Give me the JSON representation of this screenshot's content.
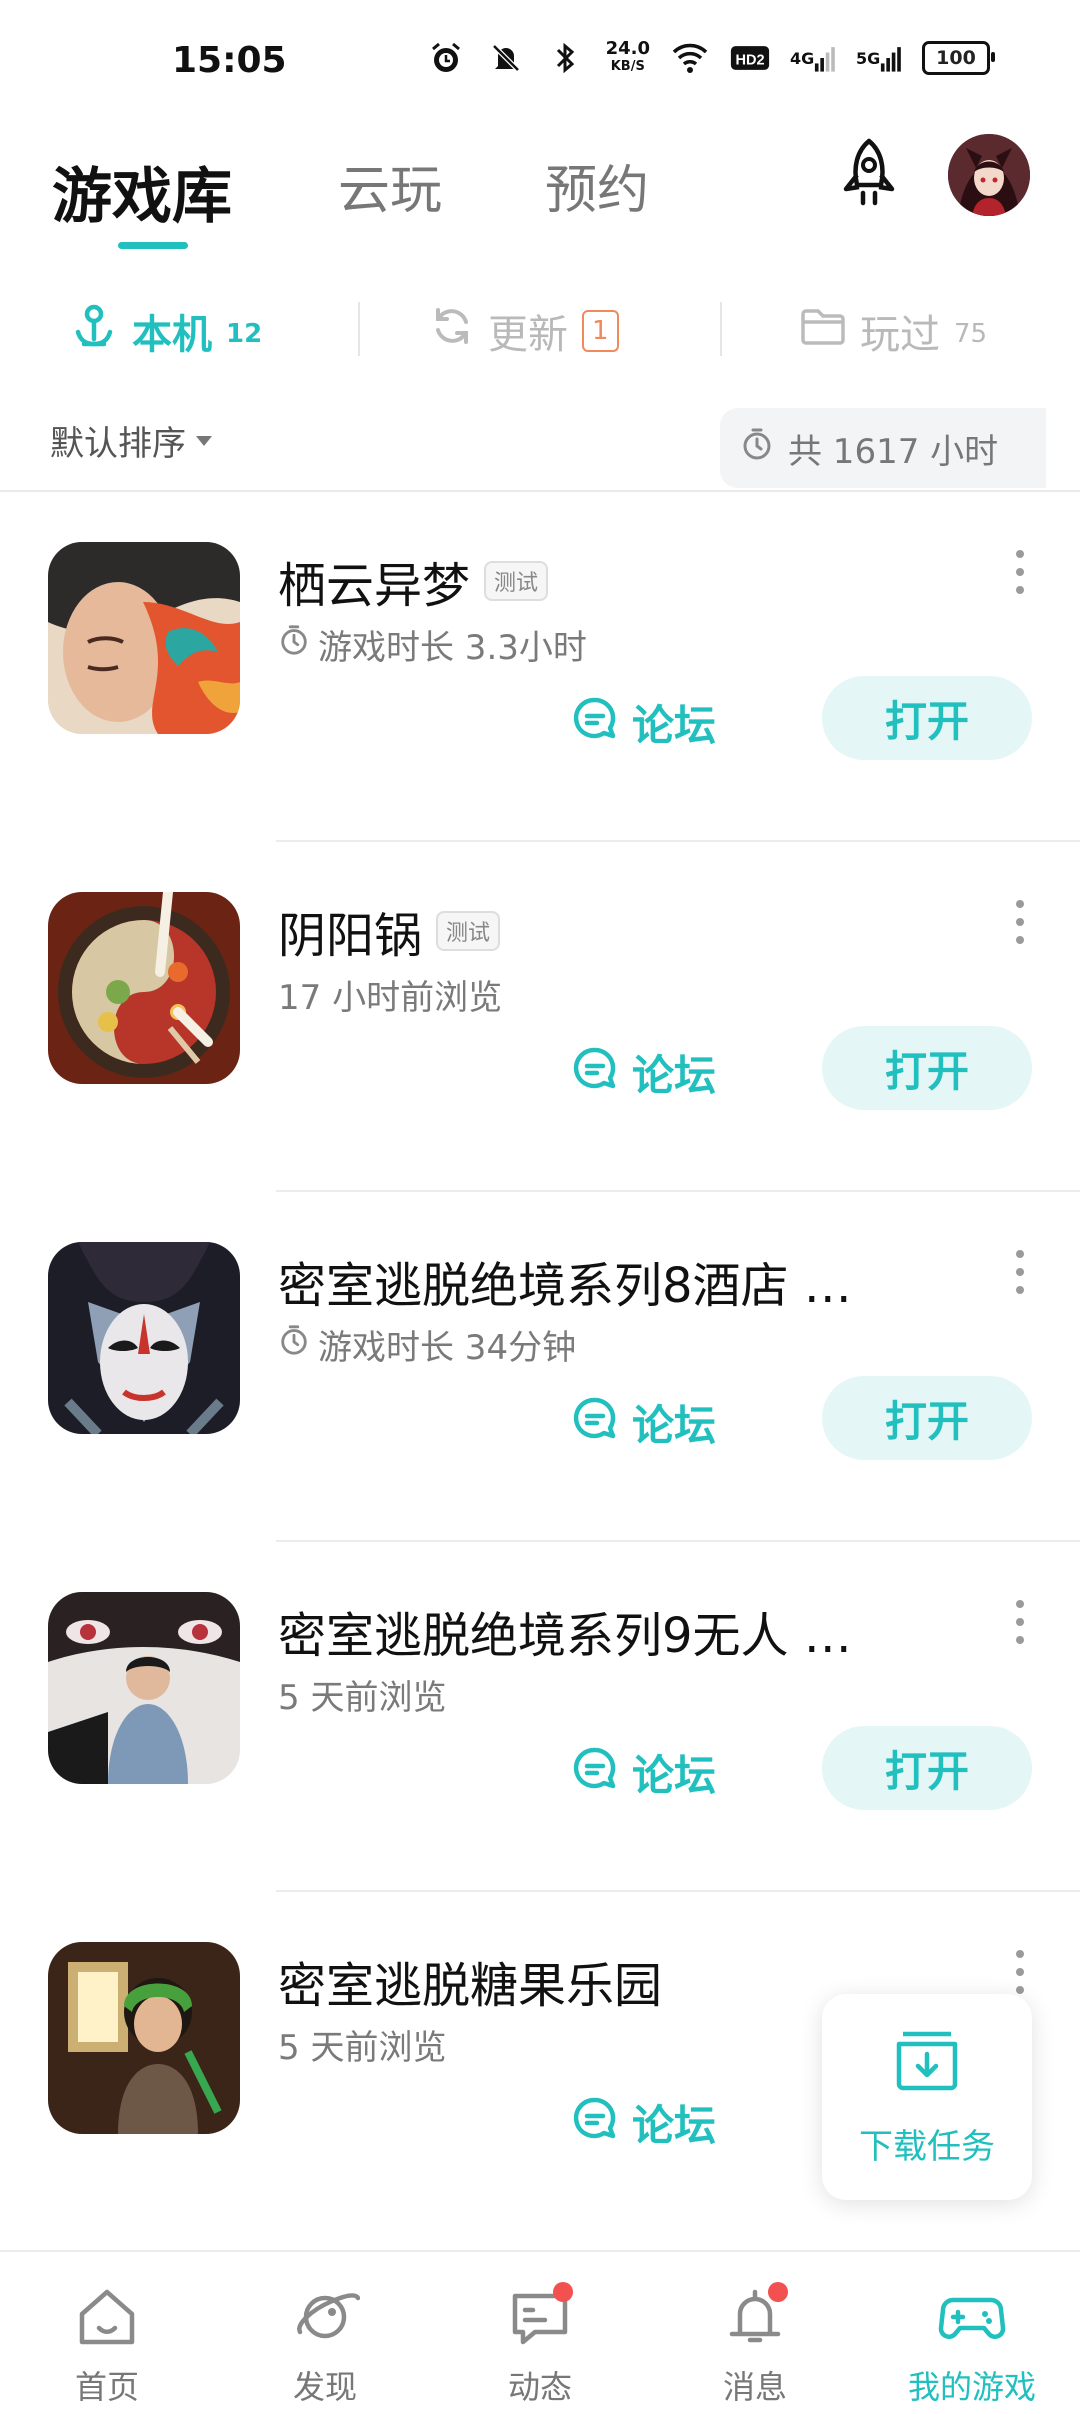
{
  "status_bar": {
    "time": "15:05",
    "speed_value": "24.0",
    "speed_unit": "KB/S",
    "hd_label": "HD2",
    "net1": "4G",
    "net2": "5G",
    "battery": "100"
  },
  "top_nav": {
    "tabs": [
      "游戏库",
      "云玩",
      "预约"
    ],
    "active_tab": "游戏库"
  },
  "sub_tabs": [
    {
      "label": "本机",
      "count": "12",
      "icon": "anchor-icon"
    },
    {
      "label": "更新",
      "badge": "1",
      "icon": "refresh-icon"
    },
    {
      "label": "玩过",
      "count": "75",
      "icon": "folder-icon"
    }
  ],
  "sort": {
    "label": "默认排序"
  },
  "total": {
    "text": "共 1617 小时"
  },
  "games": [
    {
      "title": "栖云异梦",
      "tag": "测试",
      "meta": "游戏时长 3.3小时",
      "clock": true,
      "forum": "论坛",
      "open": "打开"
    },
    {
      "title": "阴阳锅",
      "tag": "测试",
      "meta": "17 小时前浏览",
      "clock": false,
      "forum": "论坛",
      "open": "打开"
    },
    {
      "title": "密室逃脱绝境系列8酒店 …",
      "tag": "",
      "meta": "游戏时长 34分钟",
      "clock": true,
      "forum": "论坛",
      "open": "打开"
    },
    {
      "title": "密室逃脱绝境系列9无人 …",
      "tag": "",
      "meta": "5 天前浏览",
      "clock": false,
      "forum": "论坛",
      "open": "打开"
    },
    {
      "title": "密室逃脱糖果乐园",
      "tag": "",
      "meta": "5 天前浏览",
      "clock": false,
      "forum": "论坛",
      "open": ""
    }
  ],
  "download": {
    "label": "下载任务"
  },
  "bottom_nav": [
    {
      "label": "首页",
      "icon": "home-icon"
    },
    {
      "label": "发现",
      "icon": "planet-icon"
    },
    {
      "label": "动态",
      "icon": "chat-icon"
    },
    {
      "label": "消息",
      "icon": "bell-icon"
    },
    {
      "label": "我的游戏",
      "icon": "gamepad-icon"
    }
  ],
  "colors": {
    "accent": "#22bfbf",
    "badge": "#f08a5d",
    "dot": "#f2514f"
  }
}
